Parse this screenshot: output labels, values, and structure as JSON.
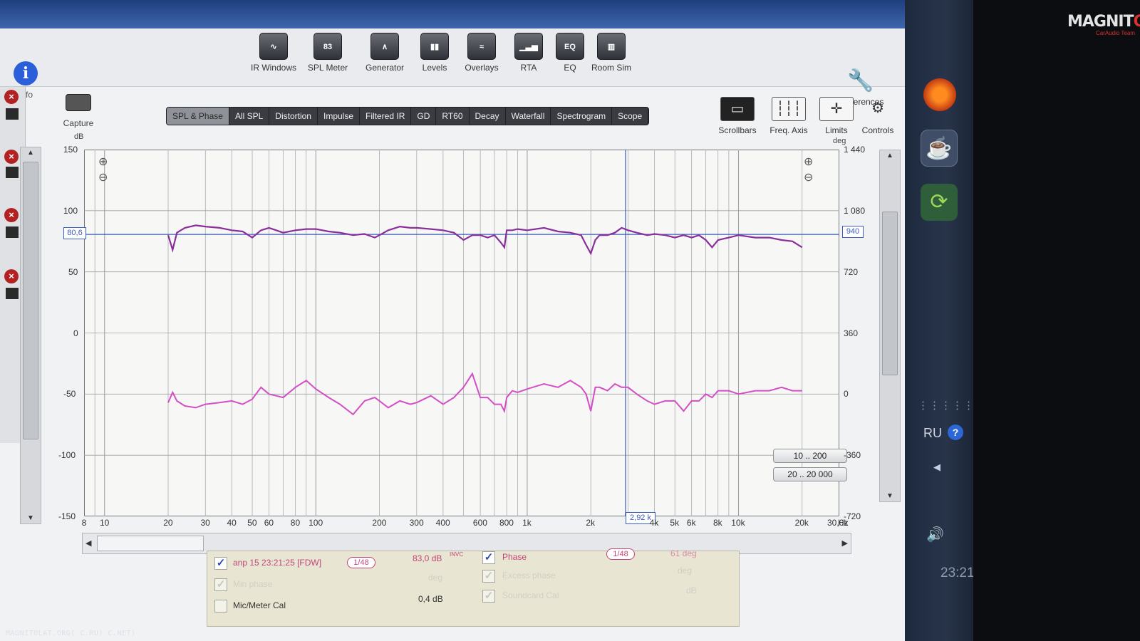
{
  "toolbar": {
    "info": "Info",
    "items": [
      {
        "label": "IR Windows",
        "icon": "ir-windows-icon",
        "glyph": "∿"
      },
      {
        "label": "SPL Meter",
        "icon": "spl-meter-icon",
        "glyph": "83"
      },
      {
        "label": "Generator",
        "icon": "generator-icon",
        "glyph": "∧"
      },
      {
        "label": "Levels",
        "icon": "levels-icon",
        "glyph": "▮▮"
      },
      {
        "label": "Overlays",
        "icon": "overlays-icon",
        "glyph": "≈"
      },
      {
        "label": "RTA",
        "icon": "rta-icon",
        "glyph": "▁▃▅"
      },
      {
        "label": "EQ",
        "icon": "eq-icon",
        "glyph": "EQ"
      },
      {
        "label": "Room Sim",
        "icon": "room-sim-icon",
        "glyph": "▥"
      }
    ],
    "preferences": "Preferences"
  },
  "capture": "Capture",
  "tabs": [
    "SPL & Phase",
    "All SPL",
    "Distortion",
    "Impulse",
    "Filtered IR",
    "GD",
    "RT60",
    "Decay",
    "Waterfall",
    "Spectrogram",
    "Scope"
  ],
  "active_tab": "SPL & Phase",
  "right_tools": [
    "Scrollbars",
    "Freq. Axis",
    "Limits",
    "Controls"
  ],
  "units": {
    "left": "dB",
    "right": "deg",
    "x": "Hz"
  },
  "readouts": {
    "y": "80,6",
    "deg": "940",
    "x": "2,92 k"
  },
  "ranges": [
    "10 .. 200",
    "20 .. 20 000"
  ],
  "legend": {
    "trace1_name": "anp 15 23:21:25 [FDW]",
    "trace1_smooth": "1/48",
    "trace1_value": "83,0 dB",
    "trace1_value_sup": "INVC",
    "trace1_phase": "Phase",
    "trace1_phase_smooth": "1/48",
    "trace1_phase_value": "61 deg",
    "min_phase": "Min phase",
    "min_phase_value": "deg",
    "excess_phase": "Excess phase",
    "excess_phase_value": "deg",
    "mic_cal": "Mic/Meter Cal",
    "mic_cal_value": "0,4 dB",
    "soundcard_cal": "Soundcard Cal",
    "soundcard_value": "dB"
  },
  "taskbar": {
    "lang": "RU",
    "clock": "23:21"
  },
  "watermark": {
    "logo": "MAGNITOLA",
    "sub": "CarAudio Team",
    "url": "MAGNITOLAT.ORG( C.RU) C.NET)"
  },
  "colors": {
    "spl_trace": "#8a2e9c",
    "phase_trace": "#d44ec6",
    "cursor": "#3b5bbd",
    "grid": "#9fa1a4"
  },
  "chart_data": {
    "type": "line",
    "x_scale": "log",
    "xlim": [
      8,
      30000
    ],
    "ylim": [
      -150,
      150
    ],
    "ylim_right": [
      -720,
      1440
    ],
    "ylabel": "dB",
    "ylabel_right": "deg",
    "xlabel": "Hz",
    "y_ticks": [
      "150",
      "100",
      "50",
      "0",
      "-50",
      "-100",
      "-150"
    ],
    "y_ticks_right": [
      "1 440",
      "1 080",
      "720",
      "360",
      "0",
      "-360",
      "-720"
    ],
    "x_ticks": [
      "8",
      "10",
      "20",
      "30",
      "40",
      "50",
      "60",
      "80",
      "100",
      "200",
      "300",
      "400",
      "600",
      "800",
      "1k",
      "2k",
      "4k",
      "5k",
      "6k",
      "8k",
      "10k",
      "20k",
      "30,0k"
    ],
    "grid": true,
    "cursor": {
      "x": 2920,
      "y": 80.6
    },
    "series": [
      {
        "name": "anp 15 23:21:25 [FDW]",
        "axis": "left",
        "x": [
          20,
          21,
          22,
          24,
          27,
          30,
          35,
          40,
          45,
          50,
          55,
          60,
          70,
          80,
          90,
          100,
          115,
          130,
          150,
          170,
          190,
          200,
          220,
          250,
          280,
          300,
          350,
          400,
          450,
          500,
          550,
          600,
          650,
          700,
          750,
          780,
          800,
          850,
          900,
          1000,
          1200,
          1400,
          1600,
          1800,
          1900,
          2000,
          2100,
          2200,
          2400,
          2600,
          2800,
          3000,
          3300,
          3700,
          4000,
          4500,
          5000,
          5500,
          6000,
          6500,
          7000,
          7500,
          8000,
          9000,
          10000,
          12000,
          14000,
          16000,
          18000,
          20000
        ],
        "y": [
          80,
          68,
          82,
          86,
          88,
          87,
          86,
          84,
          83,
          78,
          84,
          86,
          82,
          84,
          85,
          85,
          83,
          82,
          80,
          81,
          78,
          80,
          84,
          87,
          86,
          86,
          85,
          84,
          82,
          76,
          80,
          80,
          78,
          80,
          74,
          70,
          84,
          84,
          85,
          84,
          86,
          83,
          82,
          80,
          72,
          65,
          76,
          80,
          80,
          82,
          86,
          84,
          82,
          80,
          81,
          80,
          78,
          80,
          78,
          80,
          76,
          70,
          76,
          78,
          80,
          78,
          78,
          76,
          75,
          70
        ]
      },
      {
        "name": "Phase",
        "axis": "right",
        "x": [
          20,
          21,
          22,
          24,
          27,
          30,
          35,
          40,
          45,
          50,
          55,
          60,
          70,
          80,
          90,
          100,
          115,
          130,
          150,
          170,
          190,
          200,
          220,
          250,
          280,
          300,
          350,
          400,
          450,
          500,
          550,
          600,
          650,
          700,
          750,
          780,
          800,
          850,
          900,
          1000,
          1200,
          1400,
          1600,
          1800,
          1900,
          2000,
          2100,
          2200,
          2400,
          2600,
          2800,
          3000,
          3300,
          3700,
          4000,
          4500,
          5000,
          5500,
          6000,
          6500,
          7000,
          7500,
          8000,
          9000,
          10000,
          12000,
          14000,
          16000,
          18000,
          20000
        ],
        "y": [
          -50,
          10,
          -40,
          -70,
          -80,
          -60,
          -50,
          -40,
          -60,
          -30,
          40,
          0,
          -20,
          40,
          80,
          30,
          -20,
          -60,
          -120,
          -40,
          -20,
          -40,
          -80,
          -40,
          -60,
          -50,
          -10,
          -60,
          -20,
          40,
          120,
          -20,
          -20,
          -60,
          -60,
          -100,
          -20,
          20,
          10,
          30,
          60,
          40,
          80,
          40,
          0,
          -100,
          40,
          40,
          20,
          60,
          40,
          40,
          0,
          -40,
          -60,
          -40,
          -40,
          -100,
          -40,
          -40,
          0,
          -20,
          20,
          20,
          0,
          20,
          20,
          40,
          20,
          20
        ]
      }
    ]
  }
}
